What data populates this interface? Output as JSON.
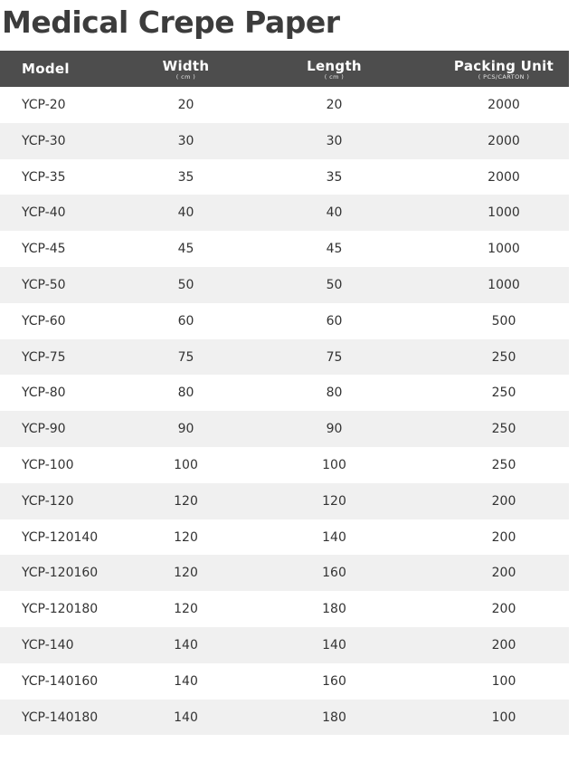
{
  "title": "Medical Crepe Paper",
  "headers": {
    "model": "Model",
    "width": "Width",
    "width_unit": "( cm )",
    "length": "Length",
    "length_unit": "( cm )",
    "packing": "Packing Unit",
    "packing_unit": "( PCS/CARTON )"
  },
  "rows": [
    {
      "model": "YCP-20",
      "width": "20",
      "length": "20",
      "packing": "2000"
    },
    {
      "model": "YCP-30",
      "width": "30",
      "length": "30",
      "packing": "2000"
    },
    {
      "model": "YCP-35",
      "width": "35",
      "length": "35",
      "packing": "2000"
    },
    {
      "model": "YCP-40",
      "width": "40",
      "length": "40",
      "packing": "1000"
    },
    {
      "model": "YCP-45",
      "width": "45",
      "length": "45",
      "packing": "1000"
    },
    {
      "model": "YCP-50",
      "width": "50",
      "length": "50",
      "packing": "1000"
    },
    {
      "model": "YCP-60",
      "width": "60",
      "length": "60",
      "packing": "500"
    },
    {
      "model": "YCP-75",
      "width": "75",
      "length": "75",
      "packing": "250"
    },
    {
      "model": "YCP-80",
      "width": "80",
      "length": "80",
      "packing": "250"
    },
    {
      "model": "YCP-90",
      "width": "90",
      "length": "90",
      "packing": "250"
    },
    {
      "model": "YCP-100",
      "width": "100",
      "length": "100",
      "packing": "250"
    },
    {
      "model": "YCP-120",
      "width": "120",
      "length": "120",
      "packing": "200"
    },
    {
      "model": "YCP-120140",
      "width": "120",
      "length": "140",
      "packing": "200"
    },
    {
      "model": "YCP-120160",
      "width": "120",
      "length": "160",
      "packing": "200"
    },
    {
      "model": "YCP-120180",
      "width": "120",
      "length": "180",
      "packing": "200"
    },
    {
      "model": "YCP-140",
      "width": "140",
      "length": "140",
      "packing": "200"
    },
    {
      "model": "YCP-140160",
      "width": "140",
      "length": "160",
      "packing": "100"
    },
    {
      "model": "YCP-140180",
      "width": "140",
      "length": "180",
      "packing": "100"
    }
  ],
  "colors": {
    "header_bg": "#4d4d4d",
    "stripe_bg": "#f0f0f0",
    "text": "#333333",
    "title": "#3c3c3c"
  }
}
